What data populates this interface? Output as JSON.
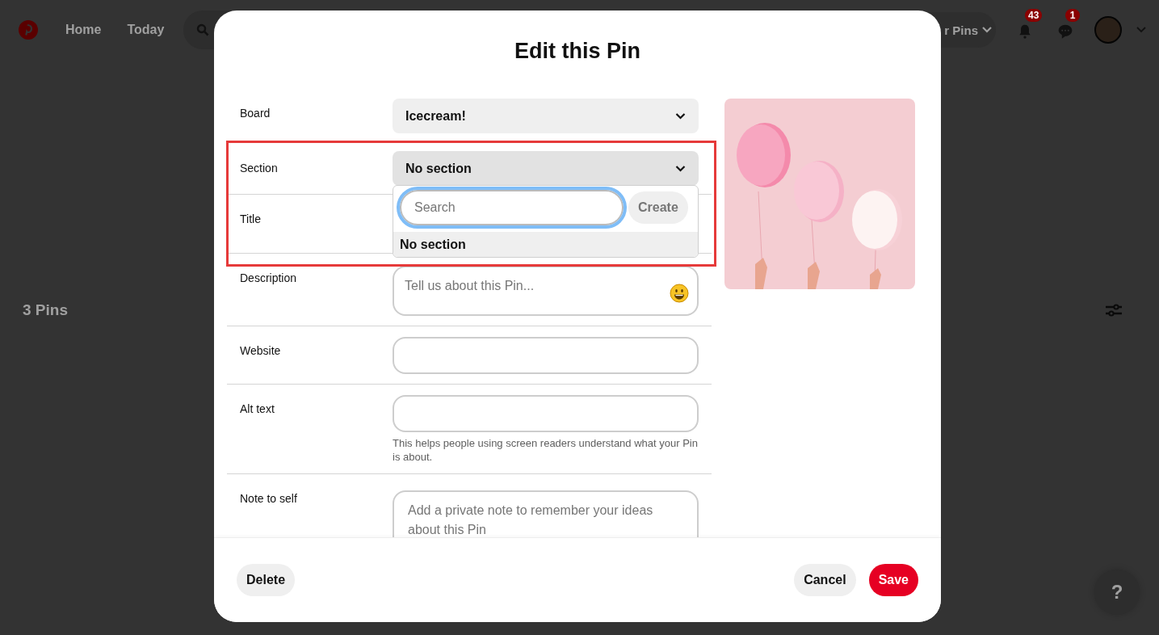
{
  "background": {
    "nav": [
      {
        "label": "Home"
      },
      {
        "label": "Today"
      }
    ],
    "your_pins_button": "r Pins",
    "notifications_badge": "43",
    "messages_badge": "1",
    "pins_count": "3 Pins",
    "help_button": "?"
  },
  "dialog": {
    "title": "Edit this Pin",
    "fields": [
      {
        "kind": "select",
        "label": "Board",
        "value": "Icecream!",
        "expanded": false
      },
      {
        "kind": "select",
        "label": "Section",
        "value": "No section",
        "expanded": true
      },
      {
        "kind": "hidden",
        "label": "Title"
      },
      {
        "kind": "textarea",
        "label": "Description",
        "placeholder": "Tell us about this Pin..."
      },
      {
        "kind": "input",
        "label": "Website"
      },
      {
        "kind": "input",
        "label": "Alt text",
        "helper": "This helps people using screen readers understand what your Pin is about."
      },
      {
        "kind": "textarea",
        "label": "Note to self",
        "placeholder": "Add a private note to remember your ideas about this Pin"
      }
    ],
    "section_dropdown": {
      "search_placeholder": "Search",
      "create_button": "Create",
      "options": [
        {
          "label": "No section",
          "selected": true
        }
      ]
    },
    "buttons": [
      {
        "label": "Delete",
        "kind": "secondary"
      },
      {
        "label": "Cancel",
        "kind": "secondary"
      },
      {
        "label": "Save",
        "kind": "primary"
      }
    ]
  }
}
